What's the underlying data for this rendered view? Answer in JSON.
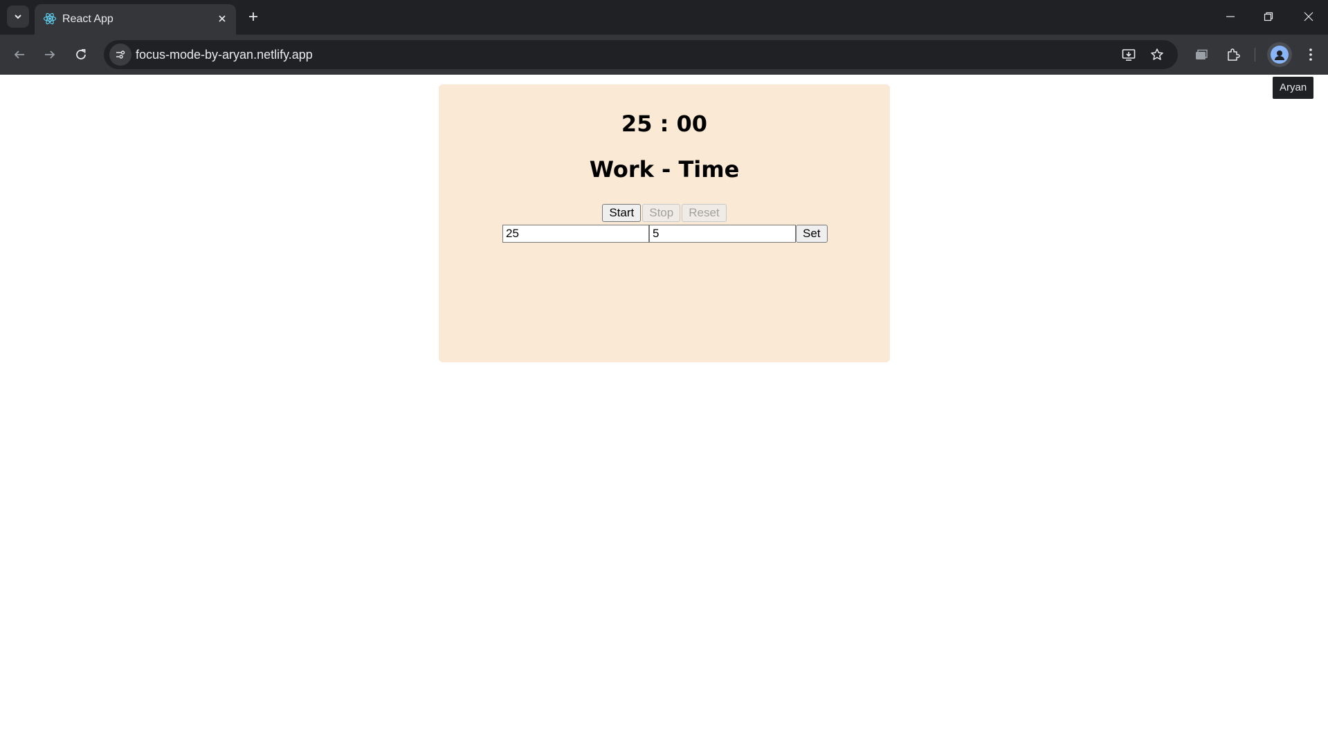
{
  "browser": {
    "tab_title": "React App",
    "url": "focus-mode-by-aryan.netlify.app",
    "profile_tooltip": "Aryan"
  },
  "timer": {
    "display": "25 : 00",
    "mode": "Work - Time"
  },
  "controls": {
    "start_label": "Start",
    "stop_label": "Stop",
    "reset_label": "Reset"
  },
  "settings": {
    "work_minutes": "25",
    "break_minutes": "5",
    "set_label": "Set"
  },
  "colors": {
    "card_background": "#f9e9d5",
    "chrome_dark": "#202124",
    "chrome_toolbar": "#35363a"
  }
}
